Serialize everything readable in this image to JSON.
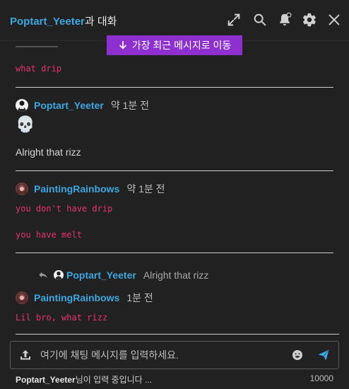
{
  "header": {
    "username": "Poptart_Yeeter",
    "title_suffix": "과 대화"
  },
  "jump_button": {
    "label": "가장 최근 메시지로 이동"
  },
  "messages": {
    "partial": {
      "text": "what drip"
    },
    "m1": {
      "author": "Poptart_Yeeter",
      "time": "약 1분 전",
      "emoji": "💀",
      "text": "Alright that rizz"
    },
    "m2": {
      "author": "PaintingRainbows",
      "time": "약 1분 전",
      "line1": "you don't have drip",
      "line2": "you have melt"
    },
    "reply": {
      "author": "Poptart_Yeeter",
      "text": "Alright that rizz"
    },
    "m3": {
      "author": "PaintingRainbows",
      "time": "1분 전",
      "text": "Lil bro, what rizz"
    }
  },
  "composer": {
    "placeholder": "여기에 채팅 메시지를 입력하세요.",
    "typing_user": "Poptart_Yeeter",
    "typing_suffix": "님이 입력 중입니다 ...",
    "char_limit": "10000"
  },
  "colors": {
    "accent": "#3ea6e0",
    "jump_bg": "#8e30d0",
    "code": "#e8336d",
    "send": "#3ea6e0"
  }
}
